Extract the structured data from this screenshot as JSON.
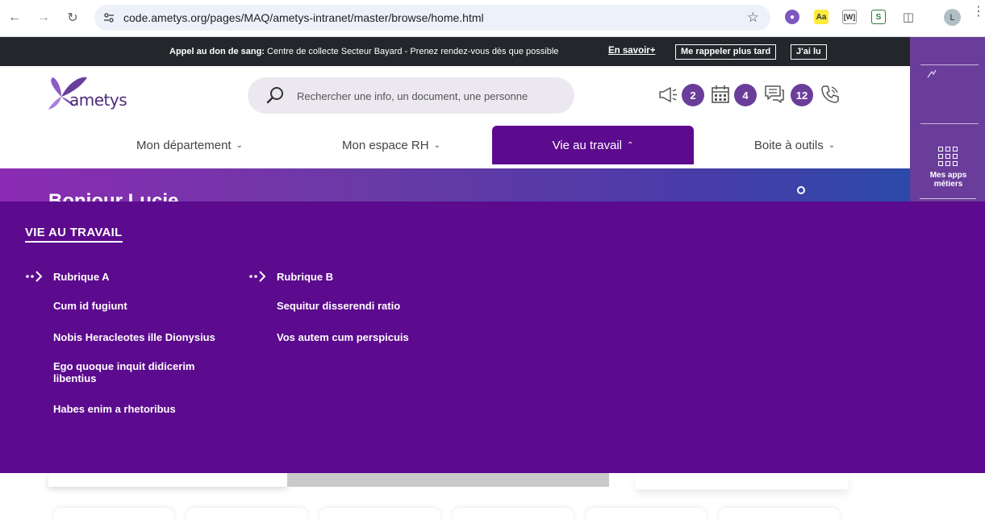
{
  "browser": {
    "url": "code.ametys.org/pages/MAQ/ametys-intranet/master/browse/home.html",
    "profile_initial": "L",
    "extensions": [
      {
        "name": "ext-purple-icon",
        "label": ""
      },
      {
        "name": "ext-aa-icon",
        "label": "Aa"
      },
      {
        "name": "ext-hw-icon",
        "label": "[W]"
      },
      {
        "name": "ext-s-icon",
        "label": "S"
      },
      {
        "name": "puzzle-icon",
        "label": ""
      }
    ]
  },
  "banner": {
    "text_bold": "Appel au don de sang:",
    "text": " Centre de collecte Secteur Bayard - Prenez rendez-vous dès que possible",
    "link": "En savoir+",
    "remind_button": "Me rappeler plus tard",
    "read_button": "J'ai lu"
  },
  "apps_panel": {
    "label_line1": "Mes apps",
    "label_line2": "métiers"
  },
  "header": {
    "logo_text": "ametys",
    "search_placeholder": "Rechercher une info, un document, une personne",
    "badges": {
      "announcements": "2",
      "calendar": "4",
      "messages": "12"
    }
  },
  "nav": {
    "items": [
      {
        "label": "Mon département"
      },
      {
        "label": "Mon espace RH"
      },
      {
        "label": "Vie au travail"
      },
      {
        "label": "Boite à outils"
      }
    ]
  },
  "hero": {
    "greeting": "Bonjour Lucie"
  },
  "mega": {
    "title": "VIE AU TRAVAIL",
    "columns": [
      {
        "heading": "Rubrique A",
        "items": [
          "Cum id fugiunt",
          "Nobis Heracleotes ille Dionysius",
          "Ego quoque inquit didicerim libentius",
          "Habes enim a rhetoribus"
        ]
      },
      {
        "heading": "Rubrique B",
        "items": [
          "Sequitur disserendi ratio",
          "Vos autem cum perspicuis"
        ]
      }
    ]
  },
  "colors": {
    "primary_purple": "#5c0a8e",
    "badge_purple": "#6a3d9a",
    "banner_dark": "#23262a"
  }
}
